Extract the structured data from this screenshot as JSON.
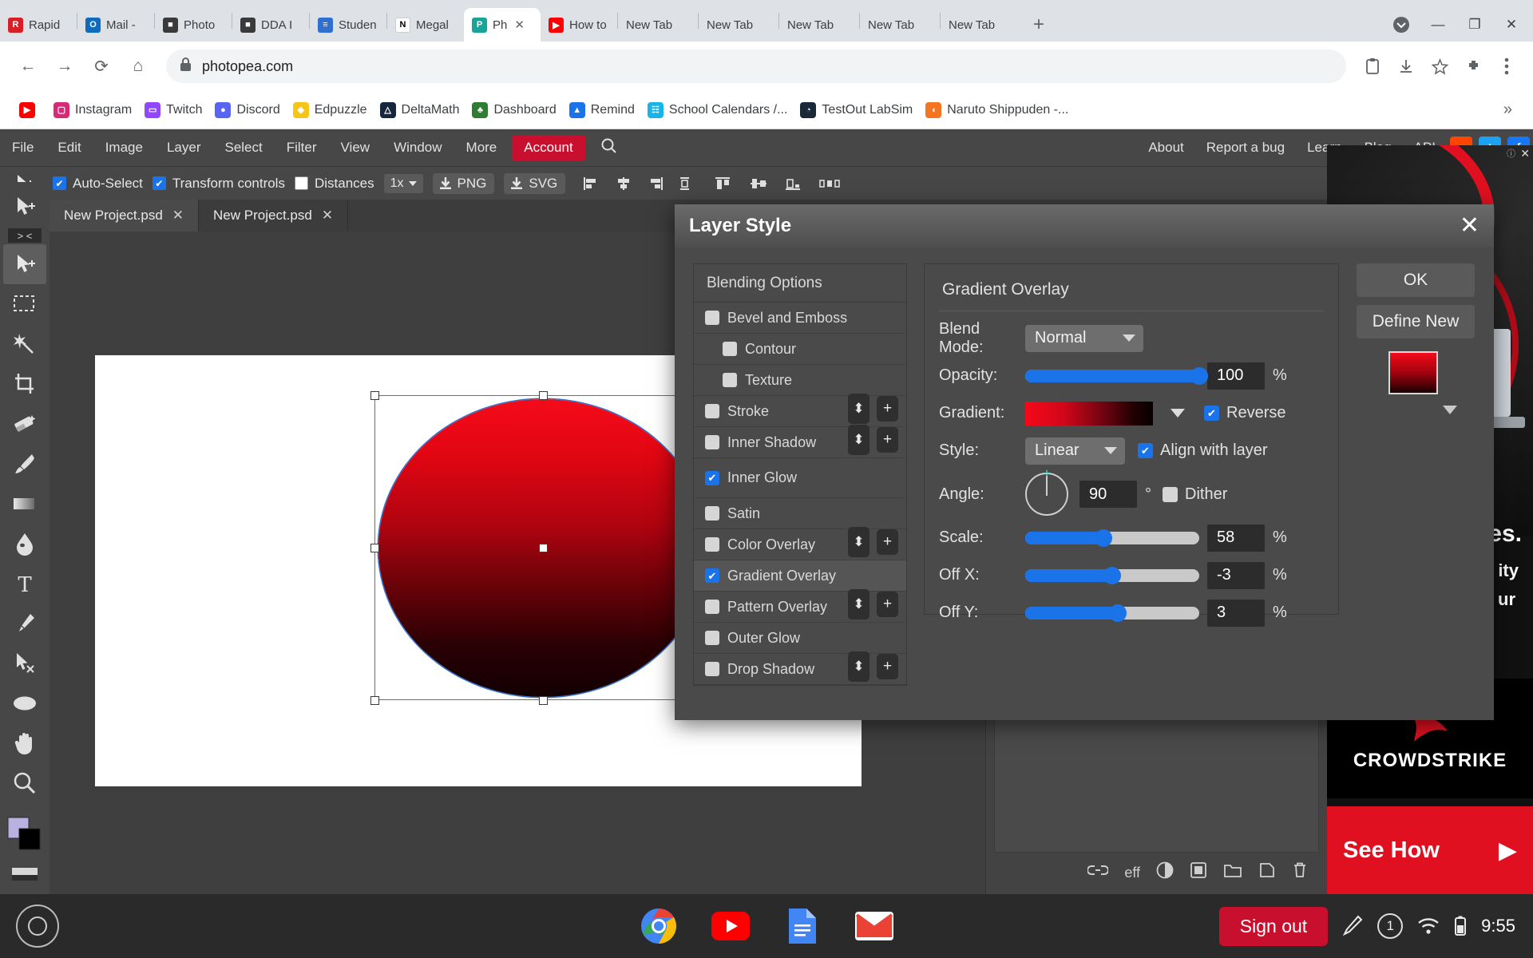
{
  "browser": {
    "tabs": [
      {
        "label": "Rapid",
        "icon": "rapididentity-icon",
        "color": "#d61f26",
        "glyph": "R",
        "active": false
      },
      {
        "label": "Mail - ",
        "icon": "outlook-icon",
        "color": "#0f6cbd",
        "glyph": "O",
        "active": false
      },
      {
        "label": "Photo",
        "icon": "contact-icon",
        "color": "#3a3a3a",
        "glyph": "■",
        "active": false
      },
      {
        "label": "DDA I ",
        "icon": "contact-icon",
        "color": "#3a3a3a",
        "glyph": "■",
        "active": false
      },
      {
        "label": "Studen",
        "icon": "student-icon",
        "color": "#2f6fd0",
        "glyph": "≡",
        "active": false
      },
      {
        "label": "Megal",
        "icon": "notion-icon",
        "color": "#ffffff",
        "glyph": "N",
        "active": false
      },
      {
        "label": "Ph",
        "icon": "photopea-icon",
        "color": "#18a497",
        "glyph": "P",
        "active": true
      },
      {
        "label": "How to",
        "icon": "youtube-icon",
        "color": "#ff0000",
        "glyph": "▶",
        "active": false
      },
      {
        "label": "New Tab",
        "icon": "none",
        "color": "transparent",
        "glyph": "",
        "active": false
      },
      {
        "label": "New Tab",
        "icon": "none",
        "color": "transparent",
        "glyph": "",
        "active": false
      },
      {
        "label": "New Tab",
        "icon": "none",
        "color": "transparent",
        "glyph": "",
        "active": false
      },
      {
        "label": "New Tab",
        "icon": "none",
        "color": "transparent",
        "glyph": "",
        "active": false
      },
      {
        "label": "New Tab",
        "icon": "none",
        "color": "transparent",
        "glyph": "",
        "active": false
      }
    ],
    "new_tab_label": "+",
    "window_controls": {
      "minimize": "—",
      "maximize": "❐",
      "close": "✕"
    },
    "nav": {
      "back": "←",
      "forward": "→",
      "reload": "⟳",
      "home": "⌂"
    },
    "address": {
      "url": "photopea.com",
      "lock": "lock-icon"
    },
    "omni_icons": [
      "clipboard-icon",
      "download-icon",
      "star-icon",
      "extensions-icon",
      "menu-icon"
    ],
    "bookmarks": [
      {
        "label": "",
        "icon": "youtube-icon",
        "color": "#ff0000",
        "glyph": "▶"
      },
      {
        "label": "Instagram",
        "icon": "instagram-icon",
        "color": "#d62976",
        "glyph": "▢"
      },
      {
        "label": "Twitch",
        "icon": "twitch-icon",
        "color": "#9146ff",
        "glyph": "▭"
      },
      {
        "label": "Discord",
        "icon": "discord-icon",
        "color": "#5865f2",
        "glyph": "●"
      },
      {
        "label": "Edpuzzle",
        "icon": "edpuzzle-icon",
        "color": "#f5c518",
        "glyph": "◆"
      },
      {
        "label": "DeltaMath",
        "icon": "deltamath-icon",
        "color": "#16263c",
        "glyph": "△"
      },
      {
        "label": "Dashboard",
        "icon": "dashboard-icon",
        "color": "#2e7d32",
        "glyph": "♣"
      },
      {
        "label": "Remind",
        "icon": "remind-icon",
        "color": "#1a73e8",
        "glyph": "▲"
      },
      {
        "label": "School Calendars /...",
        "icon": "calendar-icon",
        "color": "#18b4e8",
        "glyph": "☷"
      },
      {
        "label": "TestOut LabSim",
        "icon": "testout-icon",
        "color": "#1b2838",
        "glyph": "◔"
      },
      {
        "label": "Naruto Shippuden -...",
        "icon": "crunchyroll-icon",
        "color": "#f47521",
        "glyph": "◖"
      }
    ],
    "bookmarks_overflow": "»"
  },
  "photopea": {
    "menu": [
      "File",
      "Edit",
      "Image",
      "Layer",
      "Select",
      "Filter",
      "View",
      "Window",
      "More"
    ],
    "account_label": "Account",
    "search_icon": "search-icon",
    "right_menu": [
      "About",
      "Report a bug",
      "Learn",
      "Blog",
      "API"
    ],
    "social": [
      {
        "name": "reddit-icon",
        "color": "#ff4500",
        "glyph": "r"
      },
      {
        "name": "twitter-icon",
        "color": "#1da1f2",
        "glyph": "t"
      },
      {
        "name": "facebook-icon",
        "color": "#1877f2",
        "glyph": "f"
      }
    ],
    "options_bar": {
      "move_tool_icon": "move-tool-icon",
      "auto_select": {
        "label": "Auto-Select",
        "checked": true
      },
      "transform_controls": {
        "label": "Transform controls",
        "checked": true
      },
      "distances": {
        "label": "Distances",
        "checked": false
      },
      "zoom": "1x",
      "export_png": "PNG",
      "export_svg": "SVG",
      "align_icons": [
        "align-left",
        "align-center-h",
        "align-right",
        "distribute-h",
        "align-top",
        "align-center-v",
        "align-bottom",
        "distribute-v"
      ]
    },
    "doc_tabs": [
      {
        "label": "New Project.psd",
        "active": true,
        "close": "✕"
      },
      {
        "label": "New Project.psd",
        "active": false,
        "close": "✕"
      }
    ],
    "tools": [
      {
        "name": "move-tool",
        "selected": false
      },
      {
        "name": "move-tool-2",
        "selected": true
      },
      {
        "name": "rect-select-tool",
        "selected": false
      },
      {
        "name": "magic-wand-tool",
        "selected": false
      },
      {
        "name": "crop-tool",
        "selected": false
      },
      {
        "name": "eraser-tool",
        "selected": false
      },
      {
        "name": "brush-tool",
        "selected": false
      },
      {
        "name": "gradient-tool",
        "selected": false
      },
      {
        "name": "blur-tool",
        "selected": false
      },
      {
        "name": "type-tool",
        "selected": false
      },
      {
        "name": "pen-tool",
        "selected": false
      },
      {
        "name": "path-select-tool",
        "selected": false
      },
      {
        "name": "ellipse-tool",
        "selected": false
      },
      {
        "name": "hand-tool",
        "selected": false
      },
      {
        "name": "zoom-tool",
        "selected": false
      }
    ],
    "tool_divider_label": "> <",
    "panel_icons": [
      "link-icon",
      "eff-label",
      "mask-icon",
      "adjustment-icon",
      "folder-icon",
      "new-layer-icon",
      "trash-icon"
    ],
    "eff_label": "eff"
  },
  "layer_style": {
    "title": "Layer Style",
    "close": "✕",
    "ok_label": "OK",
    "define_new_label": "Define New",
    "blending_options_header": "Blending Options",
    "effects": [
      {
        "label": "Bevel and Emboss",
        "checked": false,
        "indent": false,
        "selected": false,
        "has_updown": false,
        "has_plus": false
      },
      {
        "label": "Contour",
        "checked": false,
        "indent": true,
        "selected": false,
        "has_updown": false,
        "has_plus": false
      },
      {
        "label": "Texture",
        "checked": false,
        "indent": true,
        "selected": false,
        "has_updown": false,
        "has_plus": false
      },
      {
        "label": "Stroke",
        "checked": false,
        "indent": false,
        "selected": false,
        "has_updown": true,
        "has_plus": true
      },
      {
        "label": "Inner Shadow",
        "checked": false,
        "indent": false,
        "selected": false,
        "has_updown": true,
        "has_plus": true
      },
      {
        "label": "Inner Glow",
        "checked": true,
        "indent": false,
        "selected": false,
        "has_updown": false,
        "has_plus": false
      },
      {
        "label": "Satin",
        "checked": false,
        "indent": false,
        "selected": false,
        "has_updown": false,
        "has_plus": false
      },
      {
        "label": "Color Overlay",
        "checked": false,
        "indent": false,
        "selected": false,
        "has_updown": true,
        "has_plus": true
      },
      {
        "label": "Gradient Overlay",
        "checked": true,
        "indent": false,
        "selected": true,
        "has_updown": false,
        "has_plus": false
      },
      {
        "label": "Pattern Overlay",
        "checked": false,
        "indent": false,
        "selected": false,
        "has_updown": true,
        "has_plus": true
      },
      {
        "label": "Outer Glow",
        "checked": false,
        "indent": false,
        "selected": false,
        "has_updown": false,
        "has_plus": false
      },
      {
        "label": "Drop Shadow",
        "checked": false,
        "indent": false,
        "selected": false,
        "has_updown": true,
        "has_plus": true
      }
    ],
    "panel": {
      "title": "Gradient Overlay",
      "blend_mode": {
        "label": "Blend Mode:",
        "value": "Normal"
      },
      "opacity": {
        "label": "Opacity:",
        "value": "100",
        "unit": "%",
        "percent": 100
      },
      "gradient": {
        "label": "Gradient:",
        "reverse_label": "Reverse",
        "reverse_checked": true,
        "from": "#f5091a",
        "to": "#060000"
      },
      "style": {
        "label": "Style:",
        "value": "Linear",
        "align_label": "Align with layer",
        "align_checked": true
      },
      "angle": {
        "label": "Angle:",
        "value": "90",
        "unit": "°",
        "dither_label": "Dither",
        "dither_checked": false
      },
      "scale": {
        "label": "Scale:",
        "value": "58",
        "unit": "%",
        "percent": 45
      },
      "off_x": {
        "label": "Off X:",
        "value": "-3",
        "unit": "%",
        "percent": 50
      },
      "off_y": {
        "label": "Off Y:",
        "value": "3",
        "unit": "%",
        "percent": 53
      }
    }
  },
  "ad": {
    "close": "✕",
    "ad_tag": "ⓘ",
    "teaser_text": "es.",
    "teaser_text2": "ity",
    "teaser_text3": "ur",
    "brand": "CROWDSTRIKE",
    "cta": "See How",
    "cta_arrow": "▶"
  },
  "taskbar": {
    "launcher_icon": "launcher-icon",
    "apps": [
      {
        "name": "chrome-icon"
      },
      {
        "name": "youtube-icon"
      },
      {
        "name": "docs-icon"
      },
      {
        "name": "gmail-icon"
      }
    ],
    "sign_out_label": "Sign out",
    "pen_icon": "stylus-icon",
    "notification_count": "1",
    "wifi_icon": "wifi-icon",
    "battery_icon": "battery-icon",
    "time": "9:55"
  }
}
